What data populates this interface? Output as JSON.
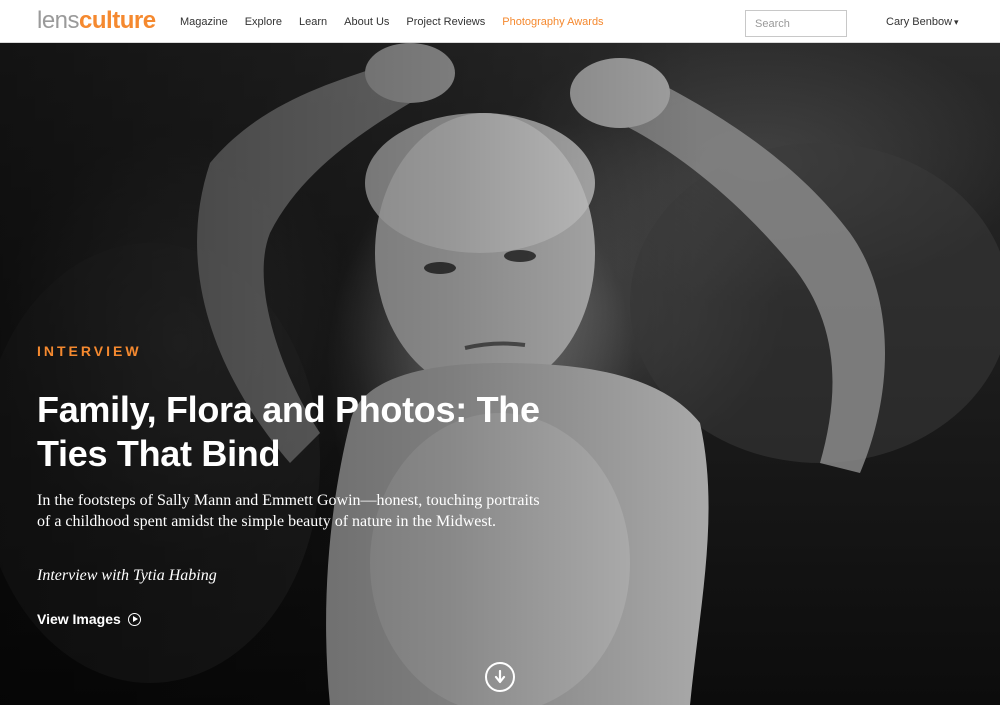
{
  "header": {
    "logo": {
      "part1": "lens",
      "part2": "culture"
    },
    "nav": [
      {
        "label": "Magazine"
      },
      {
        "label": "Explore"
      },
      {
        "label": "Learn"
      },
      {
        "label": "About Us"
      },
      {
        "label": "Project Reviews"
      },
      {
        "label": "Photography Awards",
        "highlight": true
      }
    ],
    "search_placeholder": "Search",
    "user_name": "Cary Benbow",
    "user_caret_icon": "caret-down-icon"
  },
  "hero": {
    "kicker": "INTERVIEW",
    "title": "Family, Flora and Photos: The Ties That Bind",
    "description": "In the footsteps of Sally Mann and Emmett Gowin—honest, touching portraits of a childhood spent amidst the simple beauty of nature in the Midwest.",
    "byline": "Interview with Tytia Habing",
    "view_label": "View Images",
    "view_icon": "play-circle-icon",
    "scroll_icon": "arrow-down-circle-icon"
  },
  "colors": {
    "accent": "#f5892f",
    "logo_gray": "#9a9a9a",
    "nav_text": "#333333",
    "hero_text": "#ffffff"
  }
}
